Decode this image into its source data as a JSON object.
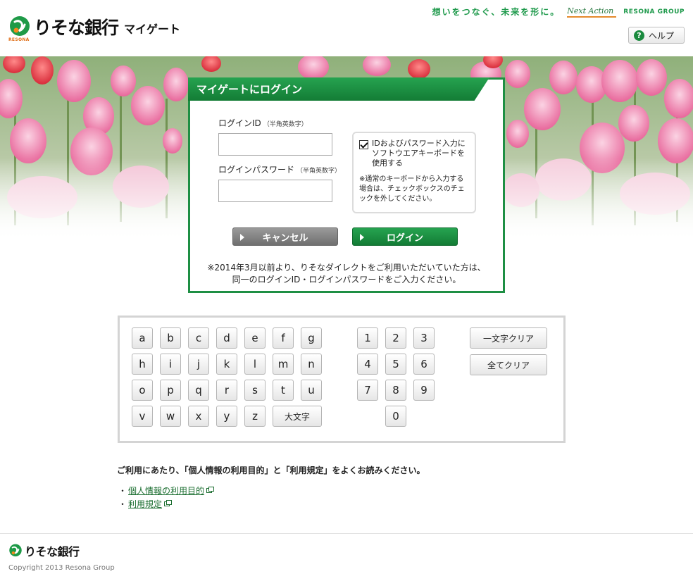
{
  "header": {
    "bank_name": "りそな銀行",
    "service_name": "マイゲート",
    "logo_small": "RESONA",
    "slogan": "想いをつなぐ、未来を形に。",
    "slogan_mark": "Next Action",
    "group": "RESONA GROUP",
    "help_label": "ヘルプ"
  },
  "login": {
    "title": "マイゲートにログイン",
    "id_label": "ログインID",
    "id_hint": "（半角英数字）",
    "id_value": "",
    "pw_label": "ログインパスワード",
    "pw_hint": "（半角英数字）",
    "pw_value": "",
    "softkb_checkbox_label": "IDおよびパスワード入力にソフトウエアキーボードを使用する",
    "softkb_checked": true,
    "softkb_note": "※通常のキーボードから入力する場合は、チェックボックスのチェックを外してください。",
    "cancel_label": "キャンセル",
    "login_label": "ログイン",
    "note_line1": "※2014年3月以前より、りそなダイレクトをご利用いただいていた方は、",
    "note_line2": "同一のログインID・ログインパスワードをご入力ください。"
  },
  "keyboard": {
    "letters": [
      [
        "a",
        "b",
        "c",
        "d",
        "e",
        "f",
        "g"
      ],
      [
        "h",
        "i",
        "j",
        "k",
        "l",
        "m",
        "n"
      ],
      [
        "o",
        "p",
        "q",
        "r",
        "s",
        "t",
        "u"
      ],
      [
        "v",
        "w",
        "x",
        "y",
        "z"
      ]
    ],
    "uppercase_label": "大文字",
    "digits": [
      [
        "1",
        "2",
        "3"
      ],
      [
        "4",
        "5",
        "6"
      ],
      [
        "7",
        "8",
        "9"
      ],
      [
        "0"
      ]
    ],
    "backspace_label": "一文字クリア",
    "clear_all_label": "全てクリア"
  },
  "terms": {
    "title": "ご利用にあたり、「個人情報の利用目的」と「利用規定」をよくお読みください。",
    "bullet": "・",
    "link1": "個人情報の利用目的",
    "link2": "利用規定"
  },
  "footer": {
    "bank_name": "りそな銀行",
    "copyright": "Copyright 2013 Resona Group"
  },
  "colors": {
    "brand_green": "#1e8f44",
    "accent_orange": "#e58a2c",
    "link_green": "#1a6d2f"
  },
  "icons": {
    "help": "question-circle-icon",
    "external": "external-window-icon",
    "arrow": "triangle-right-icon"
  }
}
